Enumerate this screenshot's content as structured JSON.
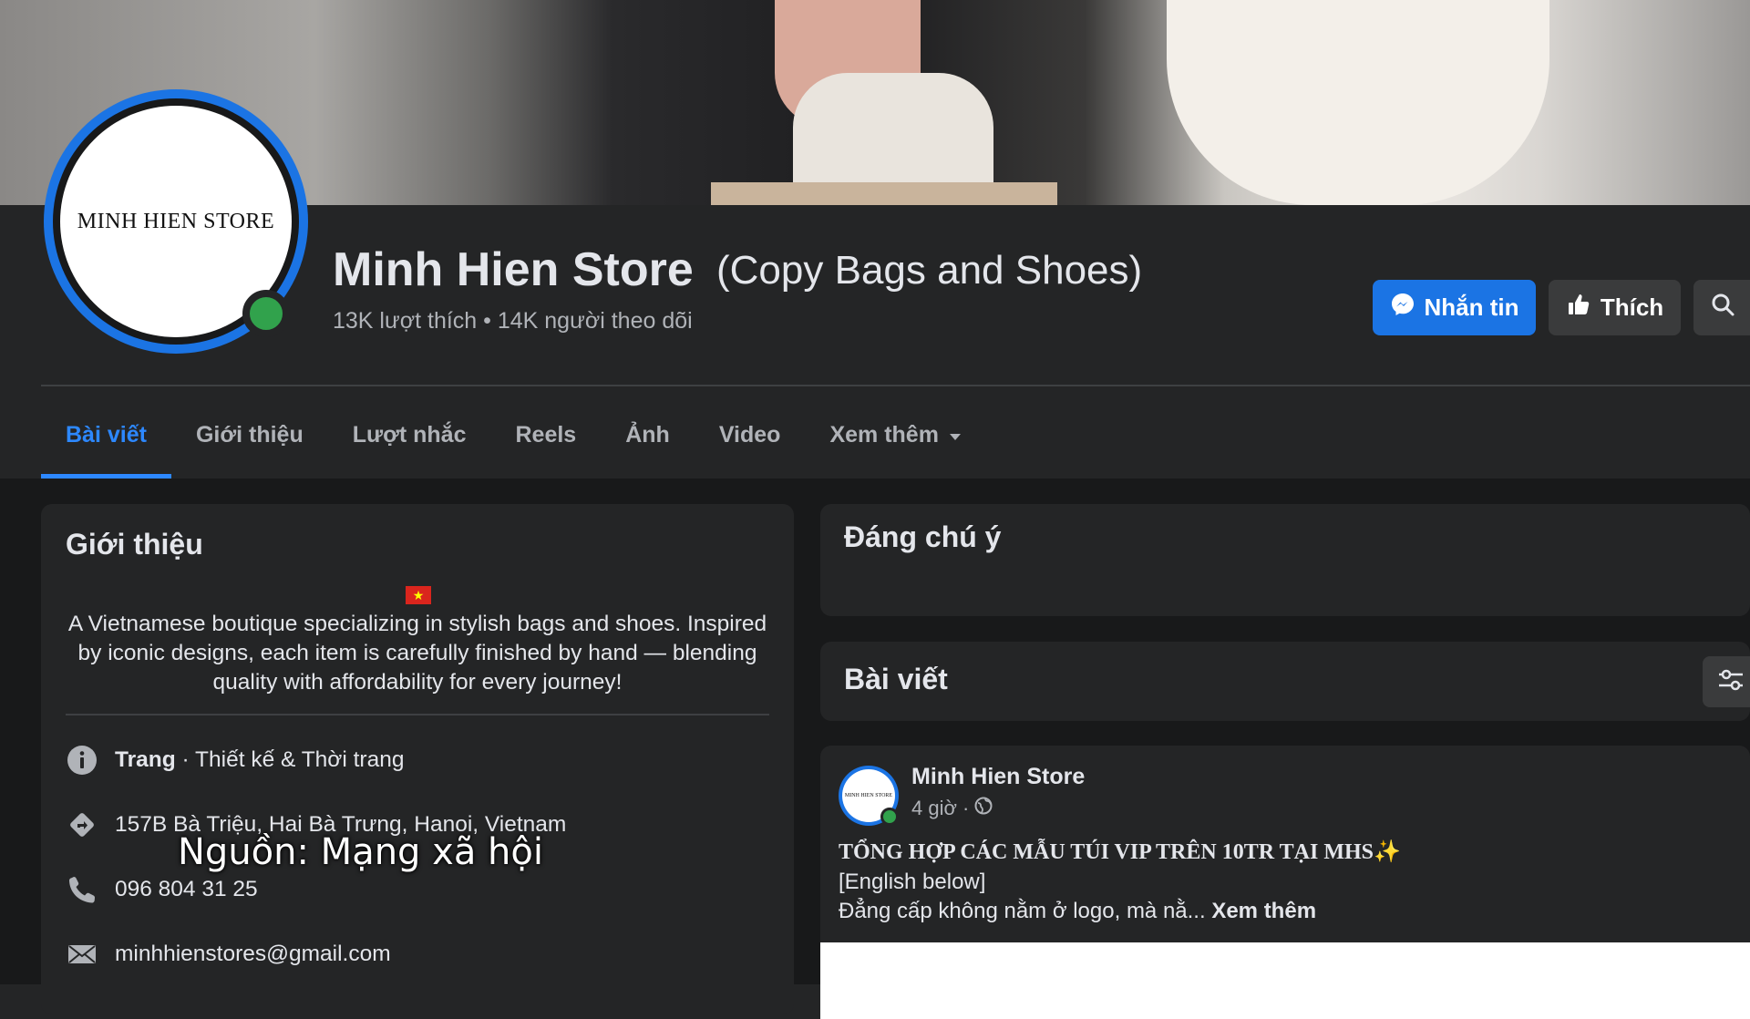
{
  "page": {
    "name": "Minh Hien Store",
    "alternate_name": "(Copy Bags and Shoes)",
    "stats": "13K lượt thích • 14K người theo dõi",
    "logo_text": "MINH HIEN STORE"
  },
  "actions": {
    "message_label": "Nhắn tin",
    "like_label": "Thích"
  },
  "tabs": [
    {
      "label": "Bài viết",
      "active": true
    },
    {
      "label": "Giới thiệu"
    },
    {
      "label": "Lượt nhắc"
    },
    {
      "label": "Reels"
    },
    {
      "label": "Ảnh"
    },
    {
      "label": "Video"
    },
    {
      "label": "Xem thêm"
    }
  ],
  "intro": {
    "title": "Giới thiệu",
    "bio": "A Vietnamese boutique specializing in stylish bags and shoes. Inspired by iconic designs, each item is carefully finished by hand — blending quality with affordability for every journey!",
    "category_prefix": "Trang",
    "category": " · Thiết kế & Thời trang",
    "address": "157B Bà Triệu, Hai Bà Trưng, Hanoi, Vietnam",
    "phone": "096 804 31 25",
    "email": "minhhienstores@gmail.com"
  },
  "watermark": "Nguồn: Mạng xã hội",
  "notable": {
    "title": "Đáng chú ý"
  },
  "posts": {
    "title": "Bài viết"
  },
  "post": {
    "author": "Minh Hien Store",
    "time": "4 giờ ·",
    "headline": "TỔNG HỢP CÁC MẪU TÚI VIP TRÊN 10TR TẠI MHS✨",
    "line2": "[English below]",
    "line3": "Đẳng cấp không nằm ở logo, mà nằ...",
    "see_more": "Xem thêm"
  },
  "colors": {
    "accent": "#2d88ff",
    "primary_button": "#1b74e4",
    "online": "#31a24c",
    "surface": "#242526",
    "background": "#18191a"
  },
  "icons": [
    "messenger-icon",
    "thumbs-up-icon",
    "search-icon",
    "chevron-down-icon",
    "info-icon",
    "location-icon",
    "phone-icon",
    "mail-icon",
    "globe-icon",
    "filter-icon"
  ]
}
